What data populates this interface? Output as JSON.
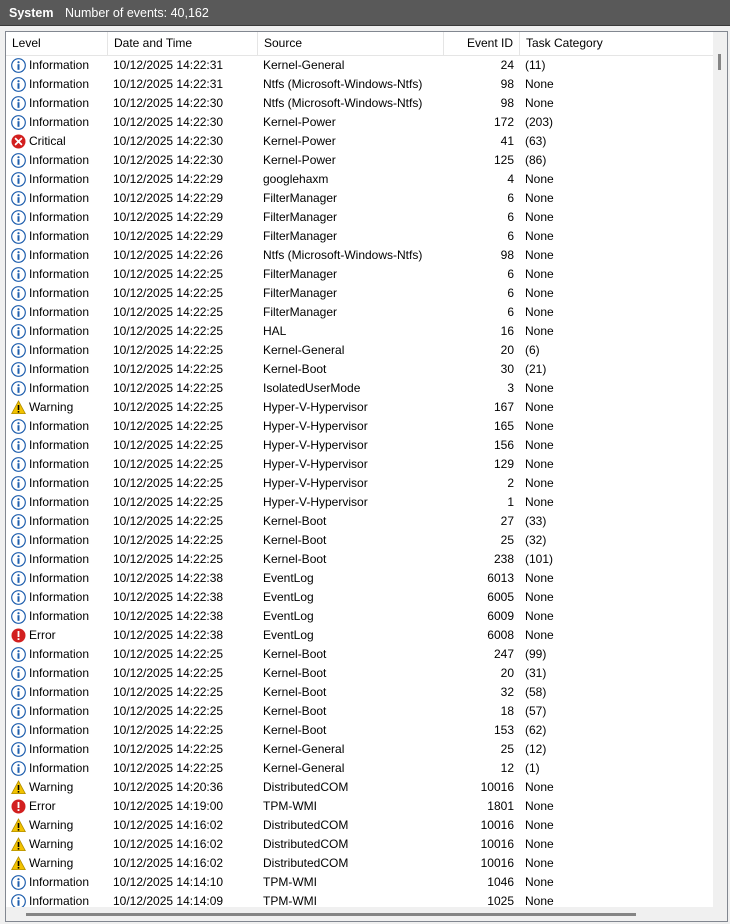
{
  "title": {
    "log_name": "System",
    "event_count": "Number of events: 40,162"
  },
  "columns": {
    "level": "Level",
    "date": "Date and Time",
    "source": "Source",
    "event_id": "Event ID",
    "category": "Task Category"
  },
  "level_colors": {
    "Information": "#1f5fae",
    "Warning": "#f2c200",
    "Error": "#d21f1f",
    "Critical": "#d21f1f"
  },
  "events": [
    {
      "level": "Information",
      "date": "10/12/2025 14:22:31",
      "source": "Kernel-General",
      "id": "24",
      "category": "(11)"
    },
    {
      "level": "Information",
      "date": "10/12/2025 14:22:31",
      "source": "Ntfs (Microsoft-Windows-Ntfs)",
      "id": "98",
      "category": "None"
    },
    {
      "level": "Information",
      "date": "10/12/2025 14:22:30",
      "source": "Ntfs (Microsoft-Windows-Ntfs)",
      "id": "98",
      "category": "None"
    },
    {
      "level": "Information",
      "date": "10/12/2025 14:22:30",
      "source": "Kernel-Power",
      "id": "172",
      "category": "(203)"
    },
    {
      "level": "Critical",
      "date": "10/12/2025 14:22:30",
      "source": "Kernel-Power",
      "id": "41",
      "category": "(63)"
    },
    {
      "level": "Information",
      "date": "10/12/2025 14:22:30",
      "source": "Kernel-Power",
      "id": "125",
      "category": "(86)"
    },
    {
      "level": "Information",
      "date": "10/12/2025 14:22:29",
      "source": "googlehaxm",
      "id": "4",
      "category": "None"
    },
    {
      "level": "Information",
      "date": "10/12/2025 14:22:29",
      "source": "FilterManager",
      "id": "6",
      "category": "None"
    },
    {
      "level": "Information",
      "date": "10/12/2025 14:22:29",
      "source": "FilterManager",
      "id": "6",
      "category": "None"
    },
    {
      "level": "Information",
      "date": "10/12/2025 14:22:29",
      "source": "FilterManager",
      "id": "6",
      "category": "None"
    },
    {
      "level": "Information",
      "date": "10/12/2025 14:22:26",
      "source": "Ntfs (Microsoft-Windows-Ntfs)",
      "id": "98",
      "category": "None"
    },
    {
      "level": "Information",
      "date": "10/12/2025 14:22:25",
      "source": "FilterManager",
      "id": "6",
      "category": "None"
    },
    {
      "level": "Information",
      "date": "10/12/2025 14:22:25",
      "source": "FilterManager",
      "id": "6",
      "category": "None"
    },
    {
      "level": "Information",
      "date": "10/12/2025 14:22:25",
      "source": "FilterManager",
      "id": "6",
      "category": "None"
    },
    {
      "level": "Information",
      "date": "10/12/2025 14:22:25",
      "source": "HAL",
      "id": "16",
      "category": "None"
    },
    {
      "level": "Information",
      "date": "10/12/2025 14:22:25",
      "source": "Kernel-General",
      "id": "20",
      "category": "(6)"
    },
    {
      "level": "Information",
      "date": "10/12/2025 14:22:25",
      "source": "Kernel-Boot",
      "id": "30",
      "category": "(21)"
    },
    {
      "level": "Information",
      "date": "10/12/2025 14:22:25",
      "source": "IsolatedUserMode",
      "id": "3",
      "category": "None"
    },
    {
      "level": "Warning",
      "date": "10/12/2025 14:22:25",
      "source": "Hyper-V-Hypervisor",
      "id": "167",
      "category": "None"
    },
    {
      "level": "Information",
      "date": "10/12/2025 14:22:25",
      "source": "Hyper-V-Hypervisor",
      "id": "165",
      "category": "None"
    },
    {
      "level": "Information",
      "date": "10/12/2025 14:22:25",
      "source": "Hyper-V-Hypervisor",
      "id": "156",
      "category": "None"
    },
    {
      "level": "Information",
      "date": "10/12/2025 14:22:25",
      "source": "Hyper-V-Hypervisor",
      "id": "129",
      "category": "None"
    },
    {
      "level": "Information",
      "date": "10/12/2025 14:22:25",
      "source": "Hyper-V-Hypervisor",
      "id": "2",
      "category": "None"
    },
    {
      "level": "Information",
      "date": "10/12/2025 14:22:25",
      "source": "Hyper-V-Hypervisor",
      "id": "1",
      "category": "None"
    },
    {
      "level": "Information",
      "date": "10/12/2025 14:22:25",
      "source": "Kernel-Boot",
      "id": "27",
      "category": "(33)"
    },
    {
      "level": "Information",
      "date": "10/12/2025 14:22:25",
      "source": "Kernel-Boot",
      "id": "25",
      "category": "(32)"
    },
    {
      "level": "Information",
      "date": "10/12/2025 14:22:25",
      "source": "Kernel-Boot",
      "id": "238",
      "category": "(101)"
    },
    {
      "level": "Information",
      "date": "10/12/2025 14:22:38",
      "source": "EventLog",
      "id": "6013",
      "category": "None"
    },
    {
      "level": "Information",
      "date": "10/12/2025 14:22:38",
      "source": "EventLog",
      "id": "6005",
      "category": "None"
    },
    {
      "level": "Information",
      "date": "10/12/2025 14:22:38",
      "source": "EventLog",
      "id": "6009",
      "category": "None"
    },
    {
      "level": "Error",
      "date": "10/12/2025 14:22:38",
      "source": "EventLog",
      "id": "6008",
      "category": "None"
    },
    {
      "level": "Information",
      "date": "10/12/2025 14:22:25",
      "source": "Kernel-Boot",
      "id": "247",
      "category": "(99)"
    },
    {
      "level": "Information",
      "date": "10/12/2025 14:22:25",
      "source": "Kernel-Boot",
      "id": "20",
      "category": "(31)"
    },
    {
      "level": "Information",
      "date": "10/12/2025 14:22:25",
      "source": "Kernel-Boot",
      "id": "32",
      "category": "(58)"
    },
    {
      "level": "Information",
      "date": "10/12/2025 14:22:25",
      "source": "Kernel-Boot",
      "id": "18",
      "category": "(57)"
    },
    {
      "level": "Information",
      "date": "10/12/2025 14:22:25",
      "source": "Kernel-Boot",
      "id": "153",
      "category": "(62)"
    },
    {
      "level": "Information",
      "date": "10/12/2025 14:22:25",
      "source": "Kernel-General",
      "id": "25",
      "category": "(12)"
    },
    {
      "level": "Information",
      "date": "10/12/2025 14:22:25",
      "source": "Kernel-General",
      "id": "12",
      "category": "(1)"
    },
    {
      "level": "Warning",
      "date": "10/12/2025 14:20:36",
      "source": "DistributedCOM",
      "id": "10016",
      "category": "None"
    },
    {
      "level": "Error",
      "date": "10/12/2025 14:19:00",
      "source": "TPM-WMI",
      "id": "1801",
      "category": "None"
    },
    {
      "level": "Warning",
      "date": "10/12/2025 14:16:02",
      "source": "DistributedCOM",
      "id": "10016",
      "category": "None"
    },
    {
      "level": "Warning",
      "date": "10/12/2025 14:16:02",
      "source": "DistributedCOM",
      "id": "10016",
      "category": "None"
    },
    {
      "level": "Warning",
      "date": "10/12/2025 14:16:02",
      "source": "DistributedCOM",
      "id": "10016",
      "category": "None"
    },
    {
      "level": "Information",
      "date": "10/12/2025 14:14:10",
      "source": "TPM-WMI",
      "id": "1046",
      "category": "None"
    },
    {
      "level": "Information",
      "date": "10/12/2025 14:14:09",
      "source": "TPM-WMI",
      "id": "1025",
      "category": "None"
    }
  ]
}
